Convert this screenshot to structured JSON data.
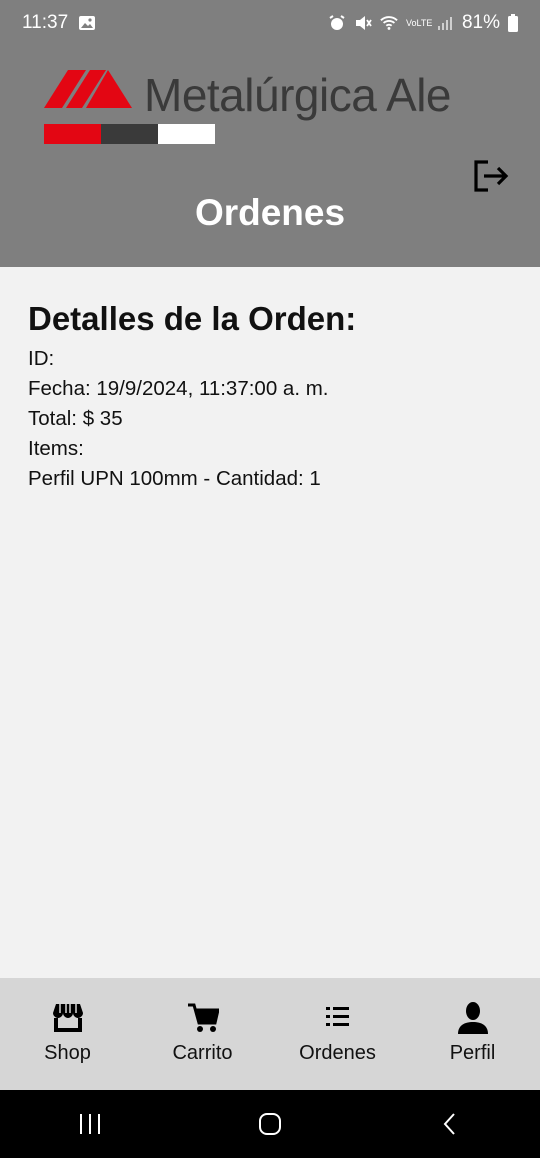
{
  "status_bar": {
    "time": "11:37",
    "battery": "81%",
    "network": "VoLTE"
  },
  "header": {
    "logo_text": "Metalúrgica Ale",
    "logo_colors": [
      "#e30613",
      "#3a3a3a",
      "#ffffff"
    ],
    "page_title": "Ordenes"
  },
  "order": {
    "heading": "Detalles de la Orden:",
    "id_line": "ID:",
    "date_line": "Fecha: 19/9/2024, 11:37:00 a. m.",
    "total_line": "Total: $ 35",
    "items_label": "Items:",
    "items": [
      "Perfil UPN 100mm - Cantidad: 1"
    ]
  },
  "bottom_nav": {
    "items": [
      {
        "label": "Shop",
        "icon": "store-icon"
      },
      {
        "label": "Carrito",
        "icon": "cart-icon"
      },
      {
        "label": "Ordenes",
        "icon": "list-icon"
      },
      {
        "label": "Perfil",
        "icon": "person-icon"
      }
    ]
  }
}
